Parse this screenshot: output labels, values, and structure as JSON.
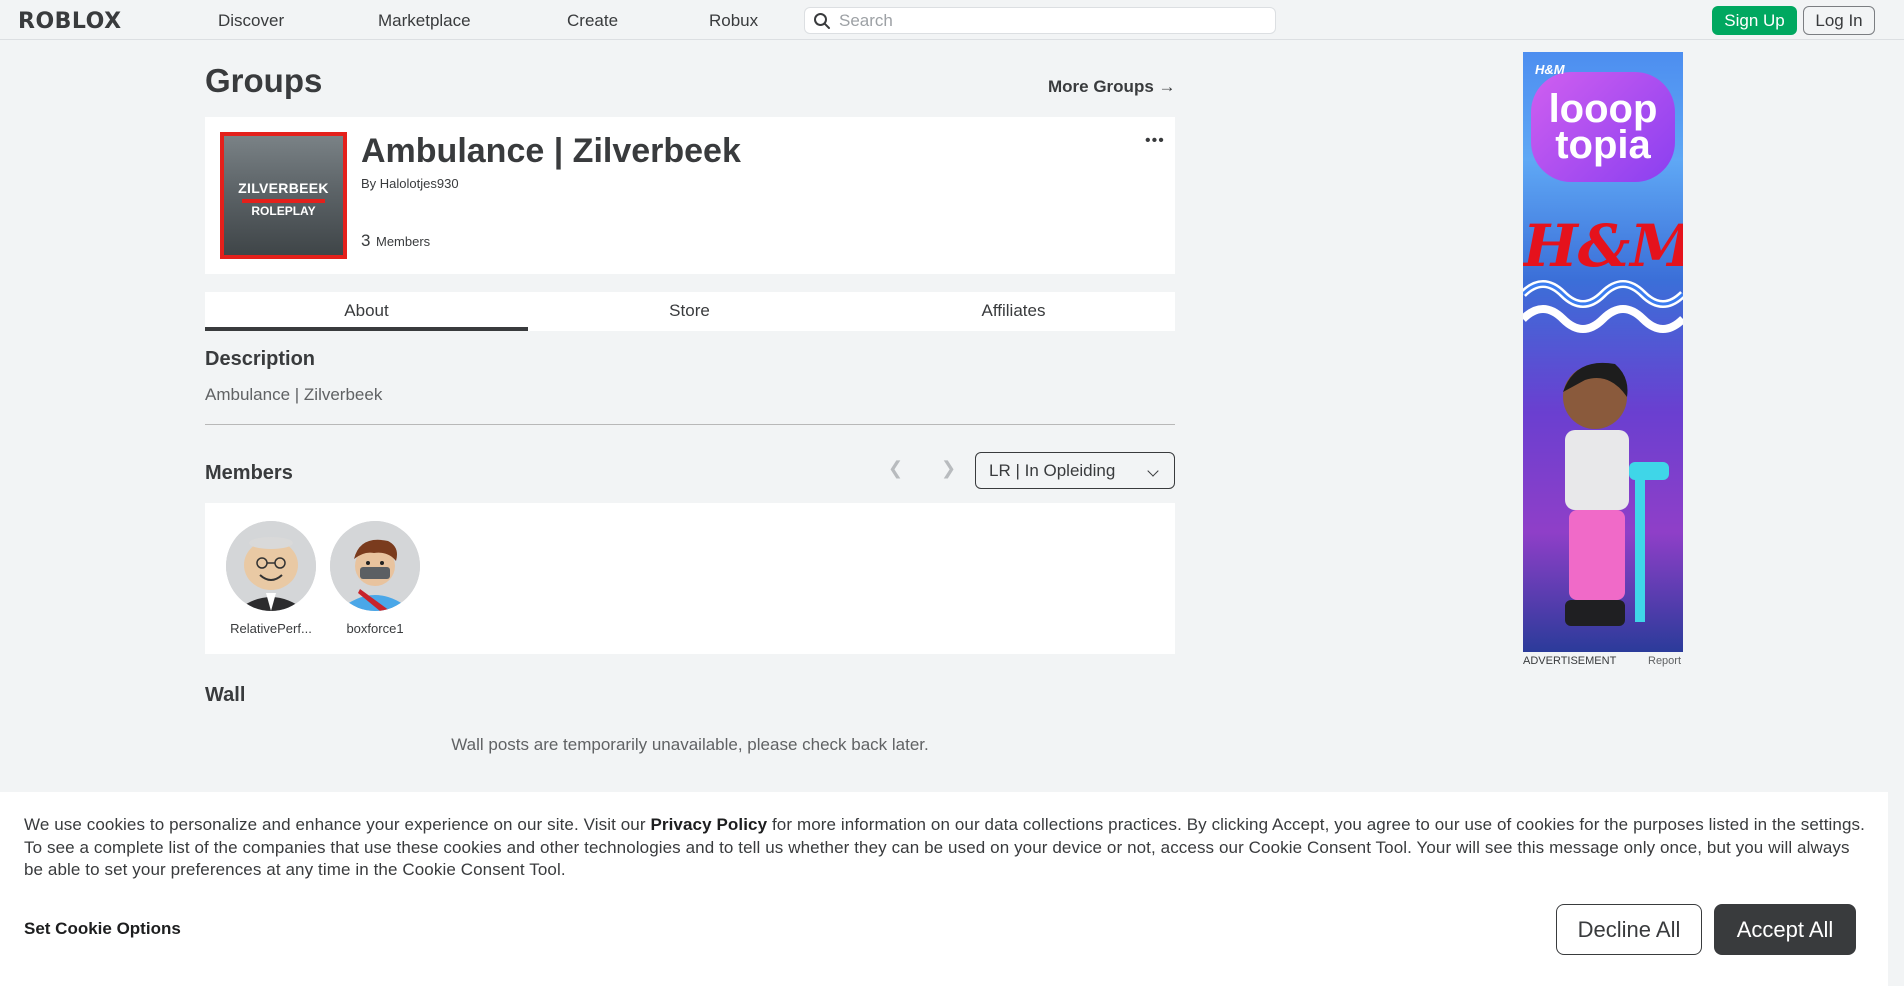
{
  "nav": {
    "logo": "ROBLOX",
    "links": [
      "Discover",
      "Marketplace",
      "Create",
      "Robux"
    ],
    "search_placeholder": "Search",
    "sign_up": "Sign Up",
    "log_in": "Log In"
  },
  "page": {
    "title": "Groups",
    "more_groups": "More Groups →"
  },
  "group": {
    "emblem_line1": "ZILVERBEEK",
    "emblem_line2": "ROLEPLAY",
    "name": "Ambulance | Zilverbeek",
    "by_label": "By",
    "owner": "Halolotjes930",
    "member_count": "3",
    "members_label": "Members",
    "more_menu": "•••",
    "emblem_border_color": "#e4201b"
  },
  "tabs": [
    {
      "label": "About",
      "active": true
    },
    {
      "label": "Store",
      "active": false
    },
    {
      "label": "Affiliates",
      "active": false
    }
  ],
  "description": {
    "heading": "Description",
    "text": "Ambulance | Zilverbeek"
  },
  "members": {
    "heading": "Members",
    "role_selected": "LR | In Opleiding",
    "list": [
      {
        "name": "RelativePerf..."
      },
      {
        "name": "boxforce1"
      }
    ]
  },
  "wall": {
    "heading": "Wall",
    "message": "Wall posts are temporarily unavailable, please check back later."
  },
  "ad": {
    "brand_small": "H&M",
    "headline_1": "looop",
    "headline_2": "topia",
    "brand": "H&M",
    "label": "ADVERTISEMENT",
    "report": "Report"
  },
  "cookie": {
    "text_before": "We use cookies to personalize and enhance your experience on our site. Visit our ",
    "link": "Privacy Policy",
    "text_after": " for more information on our data collections practices. By clicking Accept, you agree to our use of cookies for the purposes listed in the settings. To see a complete list of the companies that use these cookies and other technologies and to tell us whether they can be used on your device or not, access our Cookie Consent Tool. Your will see this message only once, but you will always be able to set your preferences at any time in the Cookie Consent Tool.",
    "set_options": "Set Cookie Options",
    "decline": "Decline All",
    "accept": "Accept All"
  },
  "colors": {
    "accent_green": "#00a860",
    "text_dark": "#393b3d",
    "background": "#f2f4f5"
  }
}
